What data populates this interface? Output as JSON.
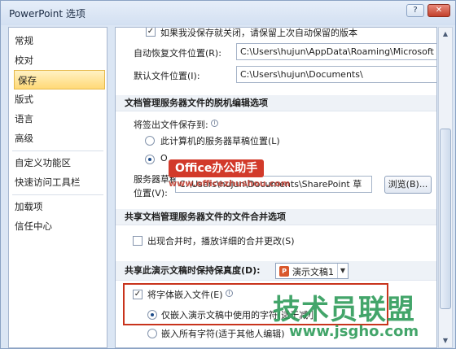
{
  "window": {
    "title": "PowerPoint 选项",
    "help_label": "?",
    "close_label": "✕"
  },
  "sidebar": {
    "items": [
      {
        "label": "常规"
      },
      {
        "label": "校对"
      },
      {
        "label": "保存",
        "selected": true
      },
      {
        "label": "版式"
      },
      {
        "label": "语言"
      },
      {
        "label": "高级"
      },
      {
        "label": "自定义功能区"
      },
      {
        "label": "快速访问工具栏"
      },
      {
        "label": "加载项"
      },
      {
        "label": "信任中心"
      }
    ]
  },
  "main": {
    "top_checkbox_label": "如果我没保存就关闭，请保留上次自动保留的版本",
    "autorecover_label": "自动恢复文件位置(R):",
    "autorecover_value": "C:\\Users\\hujun\\AppData\\Roaming\\Microsoft",
    "default_location_label": "默认文件位置(I):",
    "default_location_value": "C:\\Users\\hujun\\Documents\\",
    "offline_section": {
      "heading": "文档管理服务器文件的脱机编辑选项",
      "save_checked_out_label": "将签出文件保存到:",
      "radio1_label": "此计算机的服务器草稿位置(L)",
      "radio2_label": "O",
      "server_drafts_label_line1": "服务器草稿",
      "server_drafts_label_line2": "位置(V):",
      "server_drafts_value": "C:\\Users\\hujun\\Documents\\SharePoint 草",
      "browse_label": "浏览(B)..."
    },
    "merge_section": {
      "heading": "共享文档管理服务器文件的文件合并选项",
      "checkbox_label": "出现合并时，播放详细的合并更改(S)"
    },
    "fidelity_section": {
      "heading": "共享此演示文稿时保持保真度(D):",
      "dropdown_value": "演示文稿1",
      "embed_fonts_label": "将字体嵌入文件(E)",
      "embed_fonts_checked": true,
      "radio_only_used_label": "仅嵌入演示文稿中使用的字符(适于减小文件大小)",
      "radio_all_label": "嵌入所有字符(适于其他人编辑)"
    }
  },
  "watermarks": {
    "office_badge": "Office办公助手",
    "office_url": "www.officezhushou.com",
    "jsgho_big": "技术员联盟",
    "jsgho_url": "www.jsgho.com"
  },
  "colors": {
    "selected_nav": "#ffd977",
    "highlight_border": "#c8331c",
    "window_frame": "#dbe6f4"
  }
}
